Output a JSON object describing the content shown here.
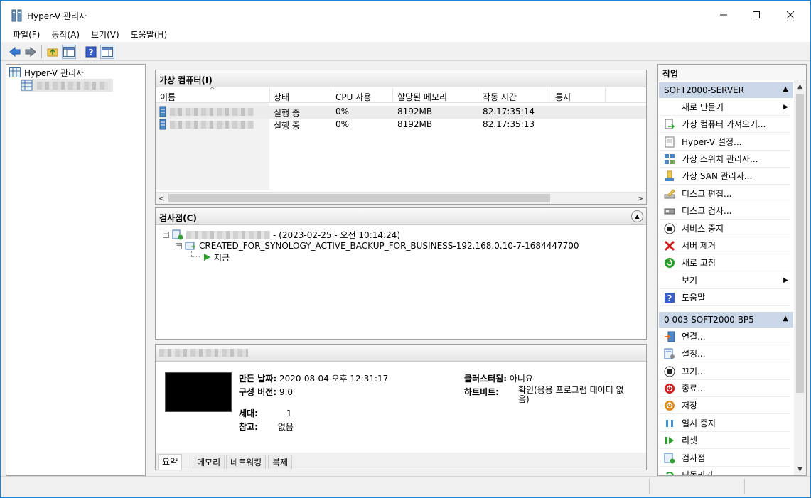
{
  "window": {
    "title": "Hyper-V 관리자"
  },
  "menu": [
    "파일(F)",
    "동작(A)",
    "보기(V)",
    "도움말(H)"
  ],
  "toolbar_icons": [
    "back-arrow-icon",
    "forward-arrow-icon",
    "folder-up-icon",
    "show-hide-console-tree-icon",
    "help-icon",
    "show-hide-action-pane-icon"
  ],
  "tree": {
    "root": "Hyper-V 관리자"
  },
  "vm_panel": {
    "title": "가상 컴퓨터(I)",
    "columns": [
      "이름",
      "상태",
      "CPU 사용",
      "할당된 메모리",
      "작동 시간",
      "통지"
    ],
    "rows": [
      {
        "state": "실행 중",
        "cpu": "0%",
        "memory": "8192MB",
        "uptime": "82.17:35:14"
      },
      {
        "state": "실행 중",
        "cpu": "0%",
        "memory": "8192MB",
        "uptime": "82.17:35:13"
      }
    ]
  },
  "checkpoints": {
    "title": "검사점(C)",
    "root_suffix": " - (2023-02-25 - 오전 10:14:24)",
    "child": "CREATED_FOR_SYNOLOGY_ACTIVE_BACKUP_FOR_BUSINESS-192.168.0.10-7-1684447700",
    "now": "지금"
  },
  "details": {
    "created_label": "만든 날짜:",
    "created_value": "2020-08-04 오후 12:31:17",
    "config_label": "구성 버전:",
    "config_value": "9.0",
    "gen_label": "세대:",
    "gen_value": "1",
    "notes_label": "참고:",
    "notes_value": "없음",
    "cluster_label": "클러스터됨:",
    "cluster_value": "아니요",
    "heartbeat_label": "하트비트:",
    "heartbeat_value": "확인(응용 프로그램 데이터 없음)",
    "tabs": [
      "요약",
      "메모리",
      "네트워킹",
      "복제"
    ]
  },
  "actions": {
    "title": "작업",
    "server_section": "SOFT2000-SERVER",
    "server_items": [
      "새로 만들기",
      "가상 컴퓨터 가져오기...",
      "Hyper-V 설정...",
      "가상 스위치 관리자...",
      "가상 SAN 관리자...",
      "디스크 편집...",
      "디스크 검사...",
      "서비스 중지",
      "서버 제거",
      "새로 고침",
      "보기",
      "도움말"
    ],
    "vm_section": "0 003 SOFT2000-BP5",
    "vm_items": [
      "연결...",
      "설정...",
      "끄기...",
      "종료...",
      "저장",
      "일시 중지",
      "리셋",
      "검사점",
      "되돌리기..."
    ]
  },
  "colors": {
    "accent_border": "#1883d7",
    "section_header": "#c9d7e8",
    "red_x": "#d01e1e",
    "green": "#2aa02a"
  }
}
